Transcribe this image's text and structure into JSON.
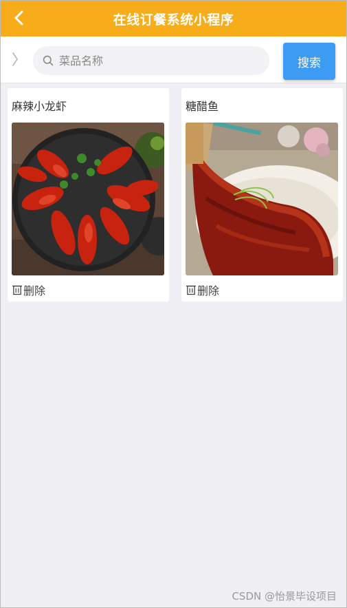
{
  "header": {
    "title": "在线订餐系统小程序",
    "back_icon": "chevron-left-icon",
    "background_color": "#f7ac1a"
  },
  "search": {
    "placeholder": "菜品名称",
    "button_label": "搜索",
    "button_color": "#3d9bf4"
  },
  "dishes": [
    {
      "name": "麻辣小龙虾",
      "delete_label": "删除",
      "image": "crayfish-photo"
    },
    {
      "name": "糖醋鱼",
      "delete_label": "删除",
      "image": "sweet-sour-fish-photo"
    }
  ],
  "watermark": "CSDN @怡景毕设项目"
}
